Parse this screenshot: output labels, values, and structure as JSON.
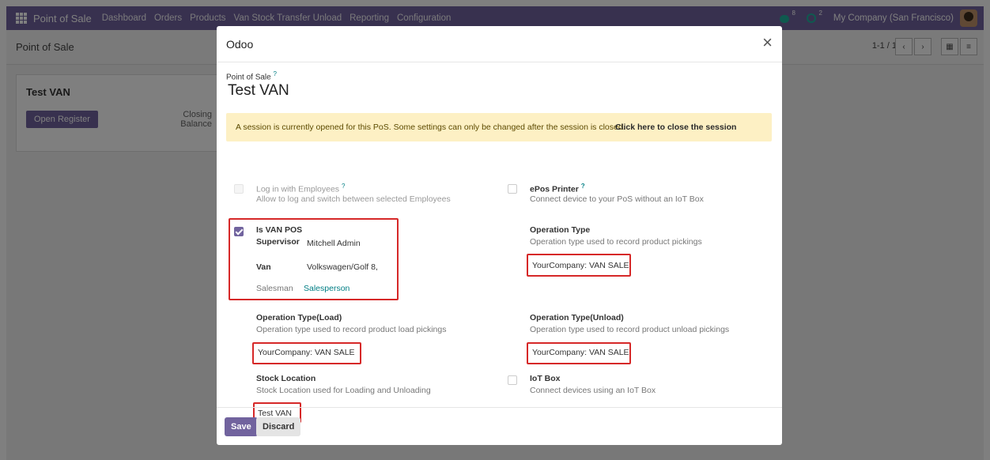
{
  "navbar": {
    "brand": "Point of Sale",
    "menu": [
      "Dashboard",
      "Orders",
      "Products",
      "Van Stock Transfer Unload",
      "Reporting",
      "Configuration"
    ],
    "messages_count": "8",
    "activities_count": "2",
    "company": "My Company (San Francisco)"
  },
  "control": {
    "title": "Point of Sale",
    "pager": "1-1 / 1"
  },
  "card": {
    "title": "Test VAN",
    "open_button": "Open Register",
    "closing_label": "Closing Balance"
  },
  "modal": {
    "title": "Odoo",
    "pos_label": "Point of Sale",
    "pos_name": "Test VAN",
    "alert_text": "A session is currently opened for this PoS. Some settings can only be changed after the session is closed.",
    "alert_link": "Click here to close the session",
    "login_employees": {
      "label": "Log in with Employees",
      "help": "Allow to log and switch between selected Employees"
    },
    "epos_printer": {
      "label": "ePos Printer",
      "help": "Connect device to your PoS without an IoT Box"
    },
    "van_pos": {
      "label": "Is VAN POS",
      "supervisor_label": "Supervisor",
      "supervisor_value": "Mitchell Admin",
      "van_label": "Van",
      "van_value": "Volkswagen/Golf 8,",
      "salesman_label": "Salesman",
      "salesman_value": "Salesperson"
    },
    "operation_type": {
      "label": "Operation Type",
      "help": "Operation type used to record product pickings",
      "value": "YourCompany: VAN SALE"
    },
    "operation_type_load": {
      "label": "Operation Type(Load)",
      "help": "Operation type used to record product load pickings",
      "value": "YourCompany: VAN SALE"
    },
    "operation_type_unload": {
      "label": "Operation Type(Unload)",
      "help": "Operation type used to record product unload pickings",
      "value": "YourCompany: VAN SALE"
    },
    "stock_location": {
      "label": "Stock Location",
      "help": "Stock Location used for Loading and Unloading",
      "value": "Test VAN"
    },
    "iot_box": {
      "label": "IoT Box",
      "help": "Connect devices using an IoT Box"
    },
    "save": "Save",
    "discard": "Discard"
  },
  "colors": {
    "brand": "#71639e",
    "highlight": "#d62828",
    "alert_bg": "#fdf0c4",
    "link": "#017e84"
  }
}
